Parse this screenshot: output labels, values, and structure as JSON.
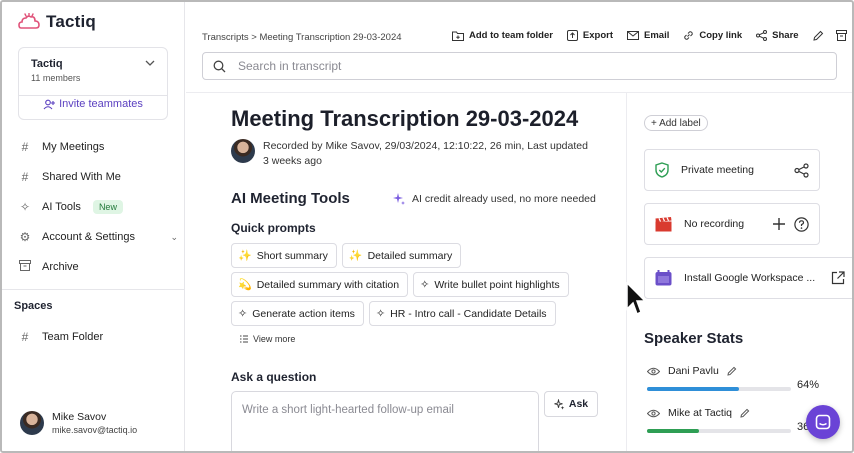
{
  "brand": {
    "name": "Tactiq",
    "accent": "#6a43d6"
  },
  "team": {
    "name": "Tactiq",
    "members": "11 members",
    "invite_label": "Invite teammates"
  },
  "nav": [
    {
      "label": "My Meetings",
      "icon": "hash-icon"
    },
    {
      "label": "Shared With Me",
      "icon": "hash-icon"
    },
    {
      "label": "AI Tools",
      "icon": "sparkles-icon",
      "badge": "New"
    },
    {
      "label": "Account & Settings",
      "icon": "sliders-icon"
    },
    {
      "label": "Archive",
      "icon": "archive-icon"
    }
  ],
  "spaces": {
    "title": "Spaces",
    "items": [
      {
        "label": "Team Folder"
      }
    ]
  },
  "user": {
    "name": "Mike Savov",
    "email": "mike.savov@tactiq.io"
  },
  "breadcrumb": "Transcripts > Meeting Transcription 29-03-2024",
  "toolbar": {
    "add_folder": "Add to team folder",
    "export": "Export",
    "email": "Email",
    "copy_link": "Copy link",
    "share": "Share"
  },
  "search": {
    "placeholder": "Search in transcript"
  },
  "meeting": {
    "title": "Meeting Transcription 29-03-2024",
    "meta_line1": "Recorded by Mike Savov, 29/03/2024, 12:10:22, 26 min, Last updated",
    "meta_line2": "3 weeks ago"
  },
  "ai_tools": {
    "title": "AI Meeting Tools",
    "credit_note": "AI credit already used, no more needed",
    "quick_prompts_title": "Quick prompts",
    "prompts": [
      {
        "emoji": "✨",
        "label": "Short summary"
      },
      {
        "emoji": "✨",
        "label": "Detailed summary"
      },
      {
        "emoji": "💫",
        "label": "Detailed summary with citation"
      },
      {
        "emoji": "✧",
        "label": "Write bullet point highlights"
      },
      {
        "emoji": "✧",
        "label": "Generate action items"
      },
      {
        "emoji": "✧",
        "label": "HR - Intro call - Candidate Details"
      }
    ],
    "view_more": "View more",
    "ask_title": "Ask a question",
    "ask_placeholder": "Write a short light-hearted follow-up email",
    "ask_button": "Ask"
  },
  "right_panel": {
    "add_label": "+ Add label",
    "cards": [
      {
        "label": "Private meeting"
      },
      {
        "label": "No recording"
      },
      {
        "label": "Install Google Workspace ..."
      }
    ],
    "speaker_stats_title": "Speaker Stats",
    "speakers": [
      {
        "name": "Dani Pavlu",
        "percent": 64,
        "pct_label": "64%",
        "color": "#2f8fd8"
      },
      {
        "name": "Mike at Tactiq",
        "percent": 36,
        "pct_label": "36",
        "color": "#2e9e54"
      }
    ]
  }
}
